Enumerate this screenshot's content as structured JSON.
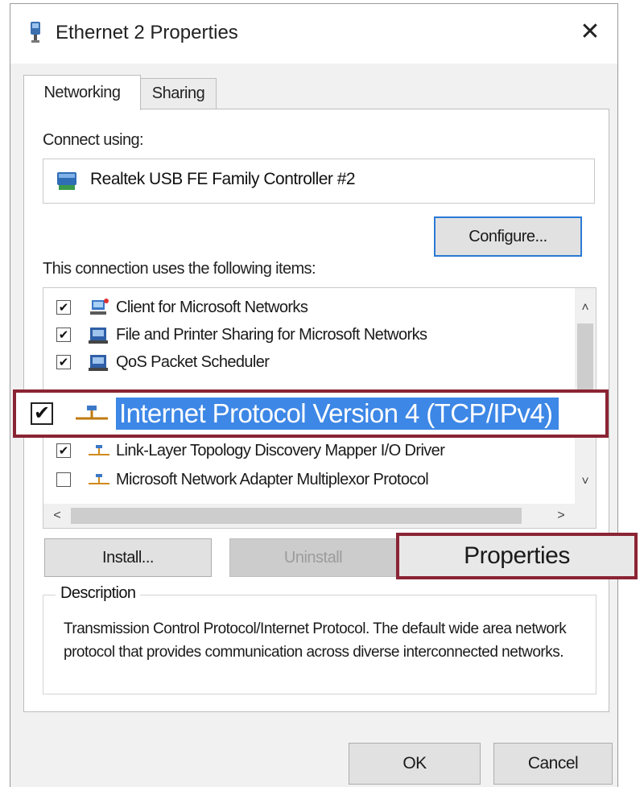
{
  "window": {
    "title": "Ethernet 2 Properties",
    "close_glyph": "✕"
  },
  "tabs": [
    {
      "label": "Networking",
      "selected": true
    },
    {
      "label": "Sharing",
      "selected": false
    }
  ],
  "connect_using": {
    "label": "Connect using:",
    "adapter_name": "Realtek USB FE Family Controller #2",
    "adapter_icon": "network-adapter-icon"
  },
  "buttons": {
    "configure": "Configure...",
    "install": "Install...",
    "uninstall": "Uninstall",
    "properties": "Properties",
    "ok": "OK",
    "cancel": "Cancel"
  },
  "items_section": {
    "label": "This connection uses the following items:",
    "items": [
      {
        "label": "Client for Microsoft Networks",
        "checked": true,
        "icon": "client-icon"
      },
      {
        "label": "File and Printer Sharing for Microsoft Networks",
        "checked": true,
        "icon": "printer-share-icon"
      },
      {
        "label": "QoS Packet Scheduler",
        "checked": true,
        "icon": "service-icon"
      },
      {
        "label": "Link-Layer Topology Discovery Mapper I/O Driver",
        "checked": true,
        "icon": "protocol-icon"
      },
      {
        "label": "Microsoft Network Adapter Multiplexor Protocol",
        "checked": false,
        "icon": "protocol-icon"
      }
    ],
    "highlighted_item": {
      "label": "Internet Protocol Version 4 (TCP/IPv4)",
      "checked": true,
      "icon": "protocol-icon"
    },
    "check_glyph": "✔",
    "scroll_glyphs": {
      "up": "˄",
      "down": "˅",
      "left": "<",
      "right": ">"
    }
  },
  "description": {
    "legend": "Description",
    "text": "Transmission Control Protocol/Internet Protocol. The default wide area network protocol that provides communication across diverse interconnected networks."
  },
  "colors": {
    "highlight_border": "#8a2434",
    "selection_bg": "#3d87e6",
    "default_button_border": "#2b79d6"
  }
}
